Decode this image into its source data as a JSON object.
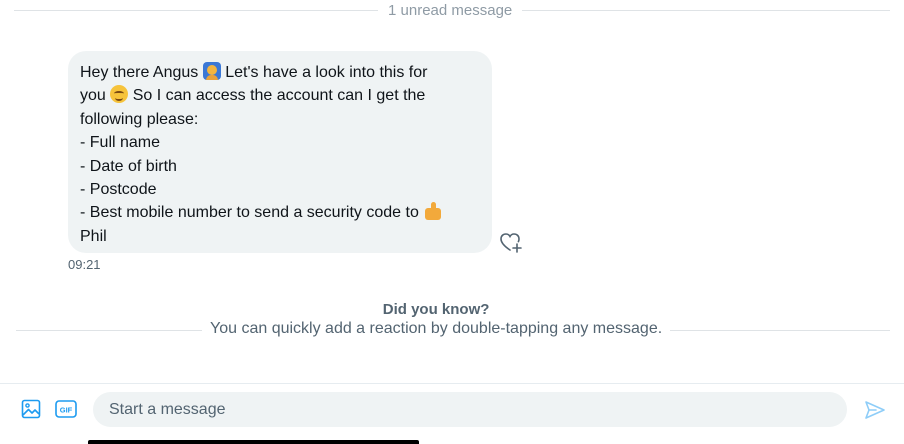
{
  "divider": {
    "unread_label": "1 unread message"
  },
  "message": {
    "lines": [
      {
        "text": "Hey there Angus ",
        "emoji": "raising-hand-emoji",
        "after": " Let's have a look into this for"
      },
      {
        "text": "you ",
        "emoji": "smiling-face-emoji",
        "after": " So I can access the account can I get the"
      },
      {
        "text": "following please:"
      },
      {
        "text": "- Full name"
      },
      {
        "text": "- Date of birth"
      },
      {
        "text": "- Postcode"
      },
      {
        "text": "- Best mobile number to send a security code to ",
        "emoji": "thumbs-up-emoji"
      },
      {
        "text": "Phil"
      }
    ],
    "time": "09:21",
    "react_icon": "heart-plus-icon"
  },
  "tip": {
    "title": "Did you know?",
    "body": "You can quickly add a reaction by double-tapping any message."
  },
  "composer": {
    "placeholder": "Start a message",
    "icons": [
      "image-icon",
      "gif-icon",
      "send-icon"
    ],
    "accent_color": "#1d9bf0",
    "send_color": "#8ecdf8"
  }
}
